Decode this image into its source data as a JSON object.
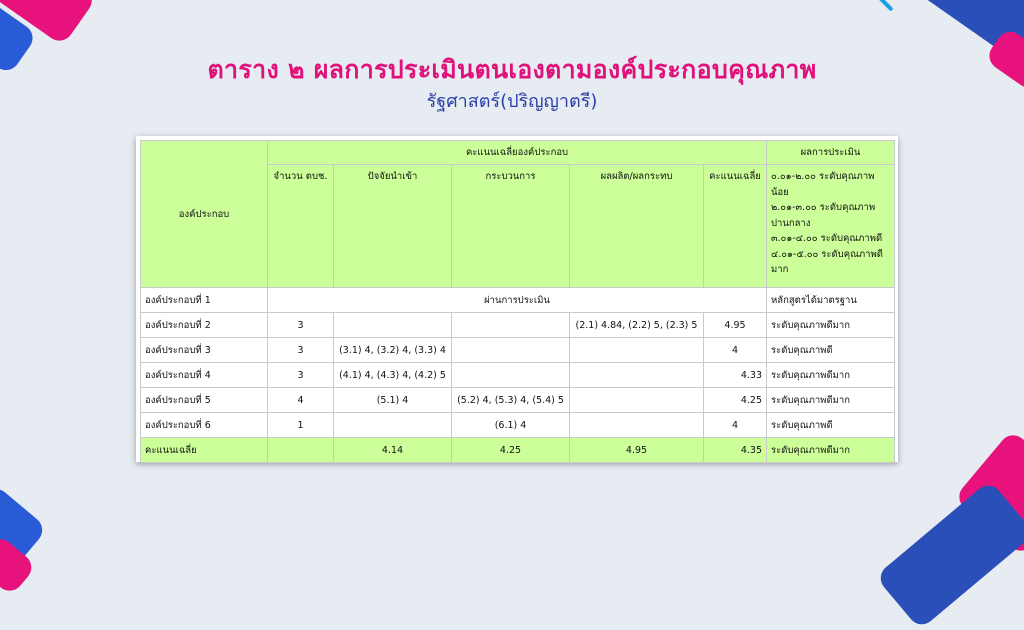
{
  "title": "ตาราง ๒ ผลการประเมินตนเองตามองค์ประกอบคุณภาพ",
  "subtitle": "รัฐศาสตร์(ปริญญาตรี)",
  "colors": {
    "title": "#e0117a",
    "subtitle": "#2b3ea8",
    "header_bg": "#ccff99",
    "accent_pink": "#e8127c",
    "accent_blue": "#2a5bd7"
  },
  "table": {
    "component_header": "องค์ประกอบ",
    "avg_group_header": "คะแนนเฉลี่ยองค์ประกอบ",
    "result_header": "ผลการประเมิน",
    "sub_headers": [
      "จำนวน ตบช.",
      "ปัจจัยนำเข้า",
      "กระบวนการ",
      "ผลผลิต/ผลกระทบ",
      "คะแนนเฉลี่ย"
    ],
    "legend": [
      "๐.๐๑-๒.๐๐ ระดับคุณภาพน้อย",
      "๒.๐๑-๓.๐๐ ระดับคุณภาพปานกลาง",
      "๓.๐๑-๔.๐๐ ระดับคุณภาพดี",
      "๔.๐๑-๕.๐๐ ระดับคุณภาพดีมาก"
    ],
    "row1": {
      "name": "องค์ประกอบที่ 1",
      "merged": "ผ่านการประเมิน",
      "result": "หลักสูตรได้มาตรฐาน"
    },
    "rows": [
      {
        "name": "องค์ประกอบที่ 2",
        "count": "3",
        "input": "",
        "process": "",
        "output": "(2.1) 4.84, (2.2) 5, (2.3) 5",
        "avg": "4.95",
        "result": "ระดับคุณภาพดีมาก"
      },
      {
        "name": "องค์ประกอบที่ 3",
        "count": "3",
        "input": "(3.1) 4, (3.2) 4, (3.3) 4",
        "process": "",
        "output": "",
        "avg": "4",
        "result": "ระดับคุณภาพดี"
      },
      {
        "name": "องค์ประกอบที่ 4",
        "count": "3",
        "input": "(4.1) 4, (4.3) 4, (4.2) 5",
        "process": "",
        "output": "",
        "avg": "4.33",
        "result": "ระดับคุณภาพดีมาก"
      },
      {
        "name": "องค์ประกอบที่ 5",
        "count": "4",
        "input": "(5.1) 4",
        "process": "(5.2) 4, (5.3) 4, (5.4) 5",
        "output": "",
        "avg": "4.25",
        "result": "ระดับคุณภาพดีมาก"
      },
      {
        "name": "องค์ประกอบที่ 6",
        "count": "1",
        "input": "",
        "process": "(6.1) 4",
        "output": "",
        "avg": "4",
        "result": "ระดับคุณภาพดี"
      }
    ],
    "total": {
      "label": "คะแนนเฉลี่ย",
      "input": "4.14",
      "process": "4.25",
      "output": "4.95",
      "avg": "4.35",
      "result": "ระดับคุณภาพดีมาก"
    }
  }
}
